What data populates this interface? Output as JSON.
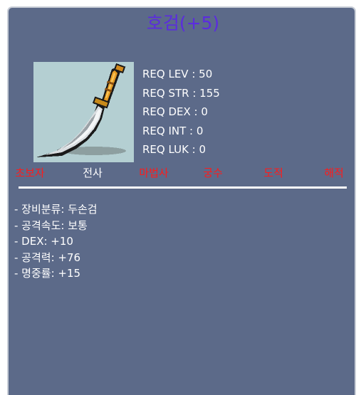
{
  "item": {
    "name": "호검(+5)",
    "icon": "two-handed-sword-icon"
  },
  "requirements": [
    "REQ LEV : 50",
    "REQ STR : 155",
    "REQ DEX : 0",
    "REQ INT : 0",
    "REQ LUK : 0"
  ],
  "jobs": [
    {
      "label": "초보자",
      "color": "#ff1a1a"
    },
    {
      "label": "전사",
      "color": "#ffffff"
    },
    {
      "label": "마법사",
      "color": "#ff1a1a"
    },
    {
      "label": "궁수",
      "color": "#ff1a1a"
    },
    {
      "label": "도적",
      "color": "#ff1a1a"
    },
    {
      "label": "해적",
      "color": "#ff1a1a"
    }
  ],
  "details": [
    "- 장비분류: 두손검",
    "- 공격속도: 보통",
    "- DEX: +10",
    "- 공격력: +76",
    "- 명중률: +15"
  ],
  "colors": {
    "panel_background": "#5c6a89",
    "title": "#5b2be0",
    "restricted_job": "#ff1a1a",
    "allowed_job": "#ffffff"
  }
}
